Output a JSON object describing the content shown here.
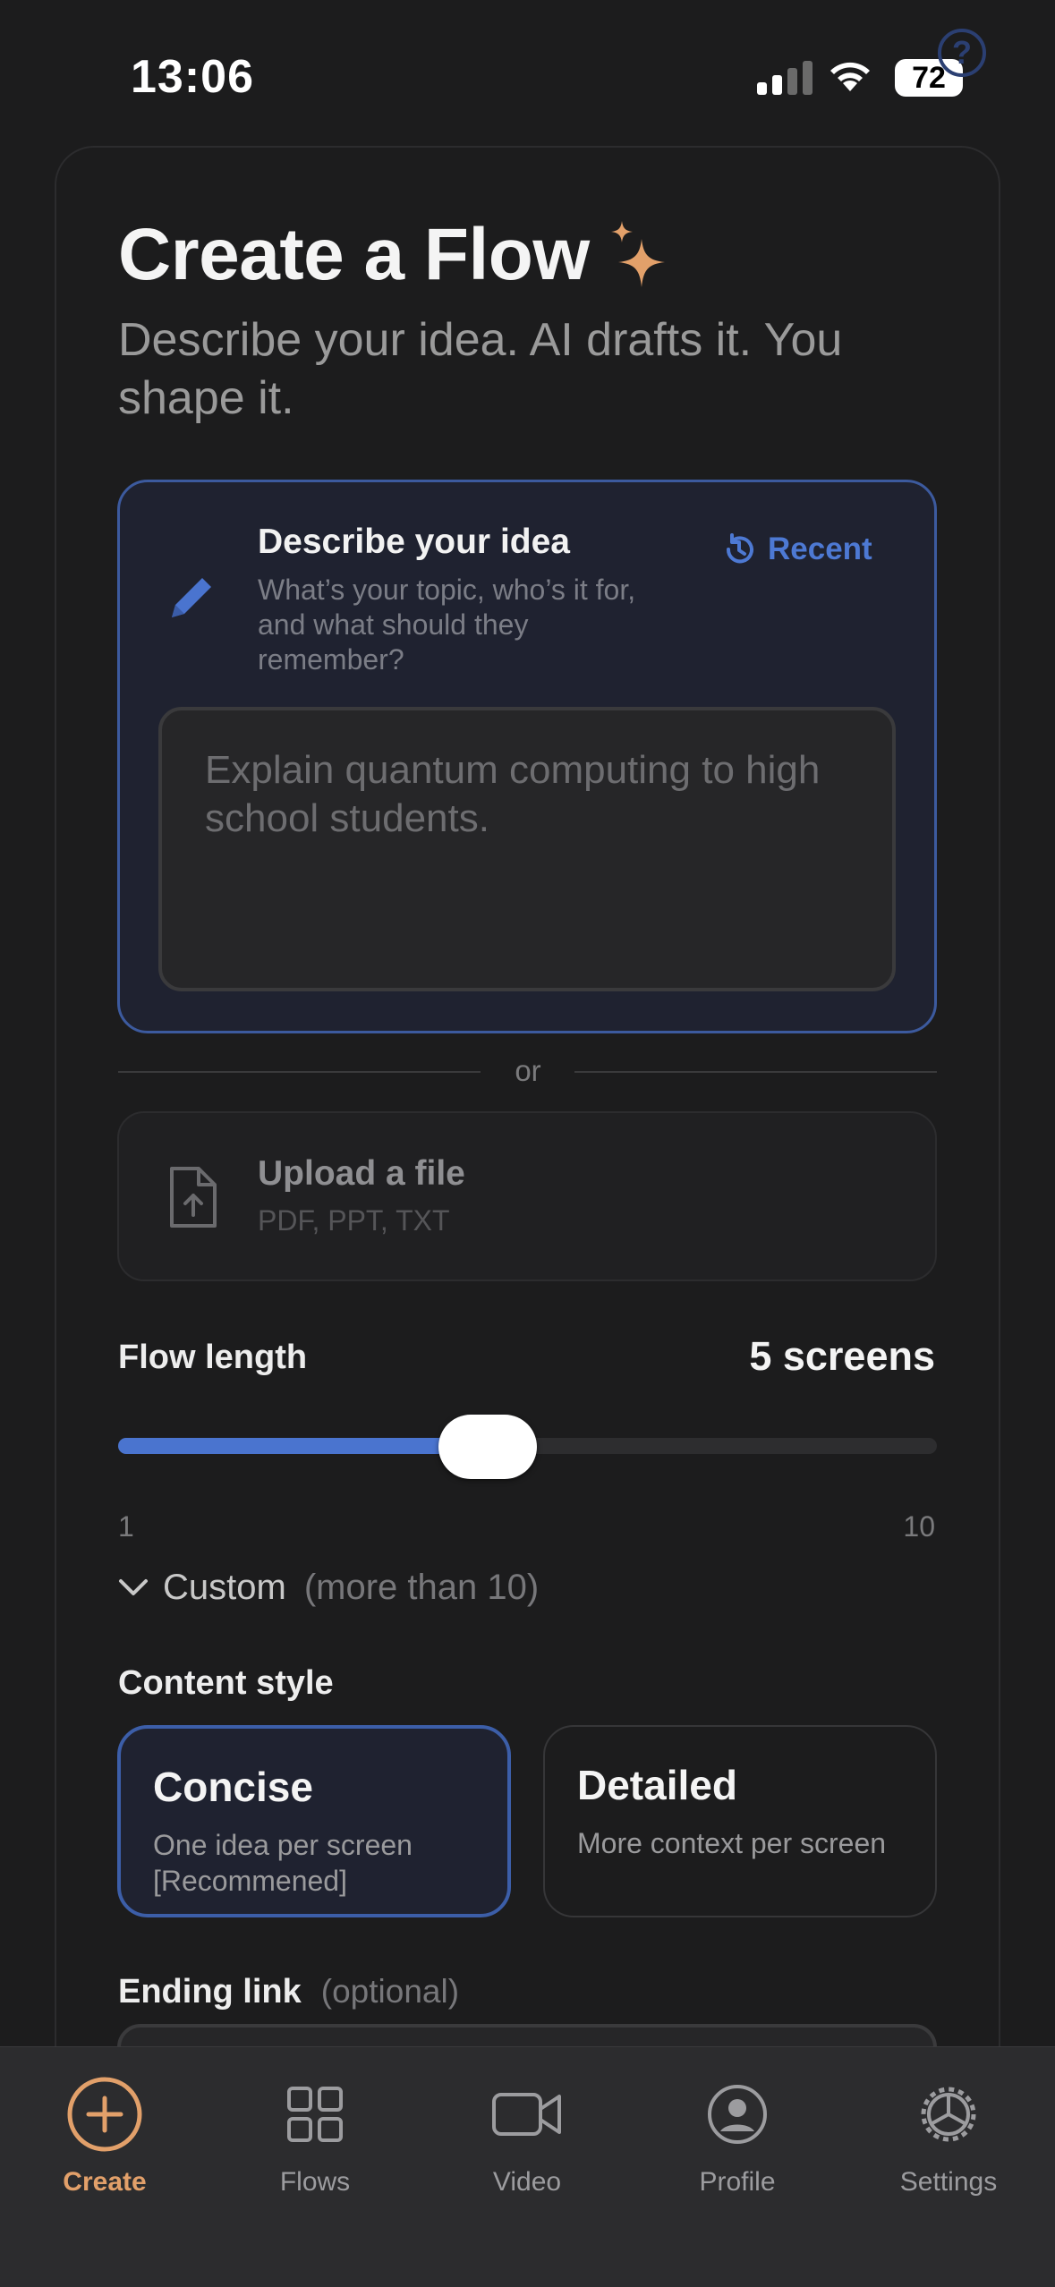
{
  "status_bar": {
    "time": "13:06",
    "battery": "72"
  },
  "header": {
    "title": "Create a Flow",
    "subtitle": "Describe your idea. AI drafts it. You shape it."
  },
  "idea": {
    "title": "Describe your idea",
    "description": "What’s your topic, who’s it for, and what should they remember?",
    "recent_label": "Recent",
    "placeholder": "Explain quantum computing to high school students.",
    "value": ""
  },
  "divider": {
    "label": "or"
  },
  "upload": {
    "title": "Upload a file",
    "formats": "PDF, PPT, TXT"
  },
  "flow_length": {
    "label": "Flow length",
    "value_text": "5 screens",
    "min": "1",
    "max": "10",
    "value": 5,
    "custom_label": "Custom",
    "custom_hint": "(more than 10)"
  },
  "content_style": {
    "label": "Content style",
    "options": [
      {
        "title": "Concise",
        "description": "One idea per screen [Recommened]",
        "selected": true
      },
      {
        "title": "Detailed",
        "description": "More context per screen",
        "selected": false
      }
    ]
  },
  "ending_link": {
    "label": "Ending link",
    "optional": "(optional)"
  },
  "tabs": [
    {
      "label": "Create",
      "icon": "plus-circle-icon",
      "active": true
    },
    {
      "label": "Flows",
      "icon": "grid-icon",
      "active": false
    },
    {
      "label": "Video",
      "icon": "video-camera-icon",
      "active": false
    },
    {
      "label": "Profile",
      "icon": "profile-icon",
      "active": false
    },
    {
      "label": "Settings",
      "icon": "gear-icon",
      "active": false
    }
  ],
  "colors": {
    "accent_blue": "#4a74cf",
    "accent_orange": "#e2a06a",
    "background": "#1c1c1d"
  }
}
